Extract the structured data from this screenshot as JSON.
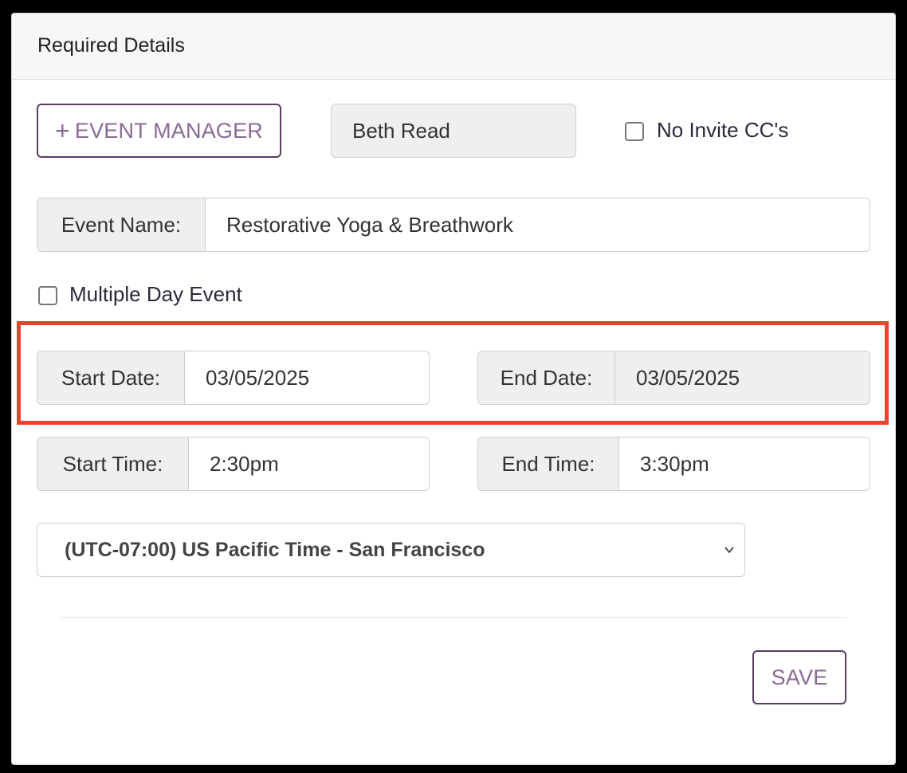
{
  "header": {
    "title": "Required Details"
  },
  "event_manager": {
    "button_label": "EVENT MANAGER",
    "current_manager": "Beth Read",
    "no_invite_cc_label": "No Invite CC's",
    "no_invite_cc_checked": false
  },
  "event_name": {
    "label": "Event Name:",
    "value": "Restorative Yoga & Breathwork"
  },
  "multiple_day": {
    "label": "Multiple Day Event",
    "checked": false
  },
  "dates": {
    "start_label": "Start Date:",
    "start_value": "03/05/2025",
    "end_label": "End Date:",
    "end_value": "03/05/2025"
  },
  "times": {
    "start_label": "Start Time:",
    "start_value": "2:30pm",
    "end_label": "End Time:",
    "end_value": "3:30pm"
  },
  "timezone": {
    "selected": "(UTC-07:00) US Pacific Time - San Francisco"
  },
  "actions": {
    "save_label": "SAVE"
  },
  "colors": {
    "accent": "#5a3d63",
    "highlight": "#e5432b"
  }
}
